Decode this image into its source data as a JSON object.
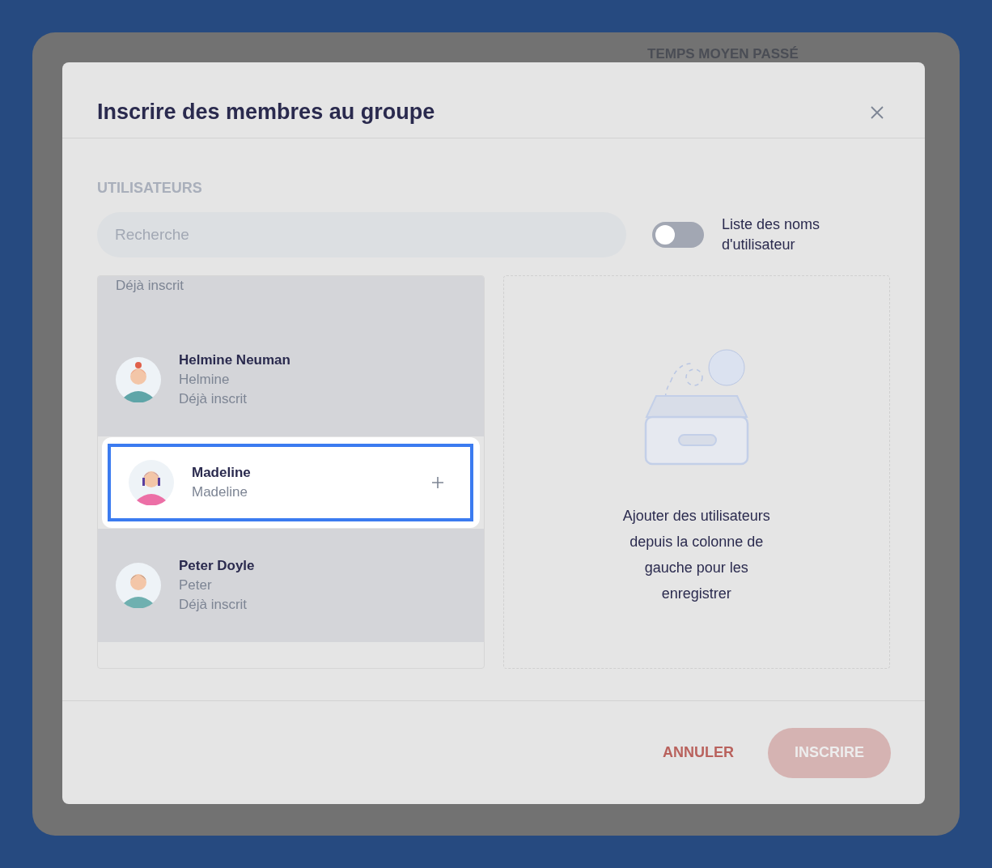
{
  "background": {
    "texts": [
      {
        "kind": "heading",
        "label": "TEMPS MOYEN PASSÉ"
      }
    ]
  },
  "dialog": {
    "title": "Inscrire des membres au groupe",
    "section_label": "UTILISATEURS",
    "search": {
      "placeholder": "Recherche"
    },
    "toggle": {
      "label": "Liste des noms d'utilisateur",
      "on": false
    },
    "users": [
      {
        "status": "Déjà inscrit",
        "enrolled": true,
        "selected": false
      },
      {
        "name": "Helmine Neuman",
        "username": "Helmine",
        "status": "Déjà inscrit",
        "enrolled": true,
        "selected": false
      },
      {
        "name": "Madeline",
        "username": "Madeline",
        "enrolled": false,
        "selected": true
      },
      {
        "name": "Peter Doyle",
        "username": "Peter",
        "status": "Déjà inscrit",
        "enrolled": true,
        "selected": false
      }
    ],
    "empty_message": "Ajouter des utilisateurs depuis la colonne de gauche pour les enregistrer",
    "buttons": [
      {
        "label": "ANNULER",
        "kind": "text",
        "disabled": false
      },
      {
        "label": "INSCRIRE",
        "kind": "primary",
        "disabled": true
      }
    ]
  }
}
